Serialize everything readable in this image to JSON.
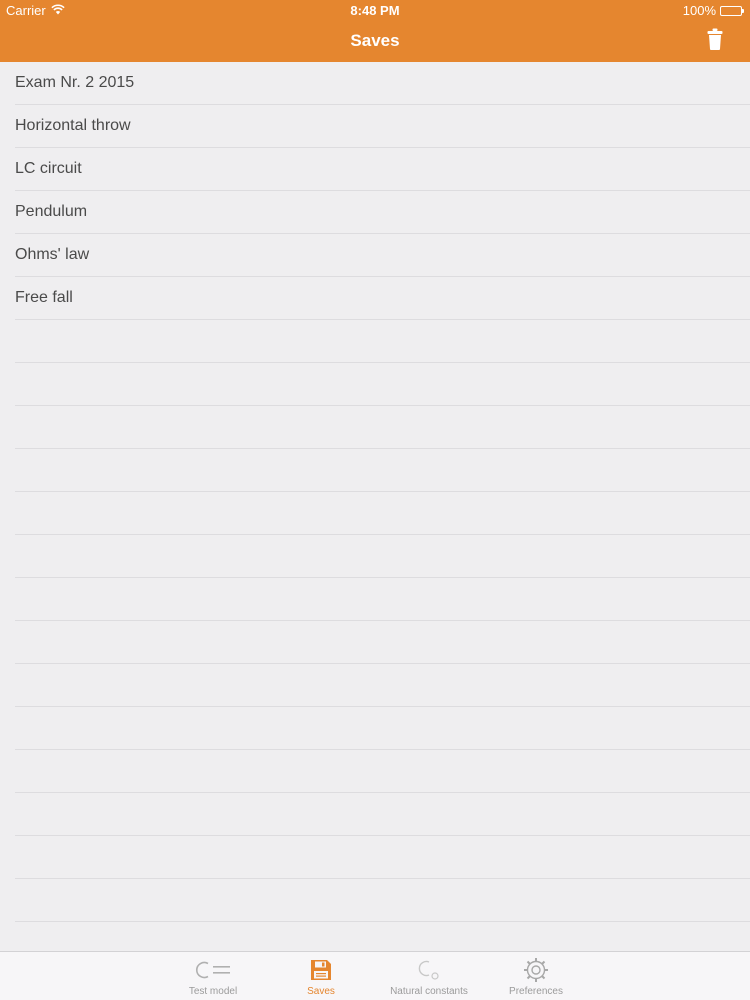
{
  "status_bar": {
    "carrier": "Carrier",
    "time": "8:48 PM",
    "battery": "100%"
  },
  "nav": {
    "title": "Saves",
    "trash_icon": "trash-icon"
  },
  "saves": [
    {
      "label": "Exam Nr. 2 2015"
    },
    {
      "label": "Horizontal throw"
    },
    {
      "label": "LC circuit"
    },
    {
      "label": "Pendulum"
    },
    {
      "label": "Ohms' law"
    },
    {
      "label": "Free fall"
    }
  ],
  "tabs": [
    {
      "label": "Test model",
      "icon": "c-equals-icon",
      "active": false
    },
    {
      "label": "Saves",
      "icon": "floppy-disk-icon",
      "active": true
    },
    {
      "label": "Natural constants",
      "icon": "constant-c-icon",
      "active": false
    },
    {
      "label": "Preferences",
      "icon": "gear-icon",
      "active": false
    }
  ],
  "colors": {
    "accent": "#e5862f",
    "background": "#efeef0",
    "separator": "#dddcdf",
    "text": "#4a4a4a",
    "inactive": "#9b9b9b"
  }
}
